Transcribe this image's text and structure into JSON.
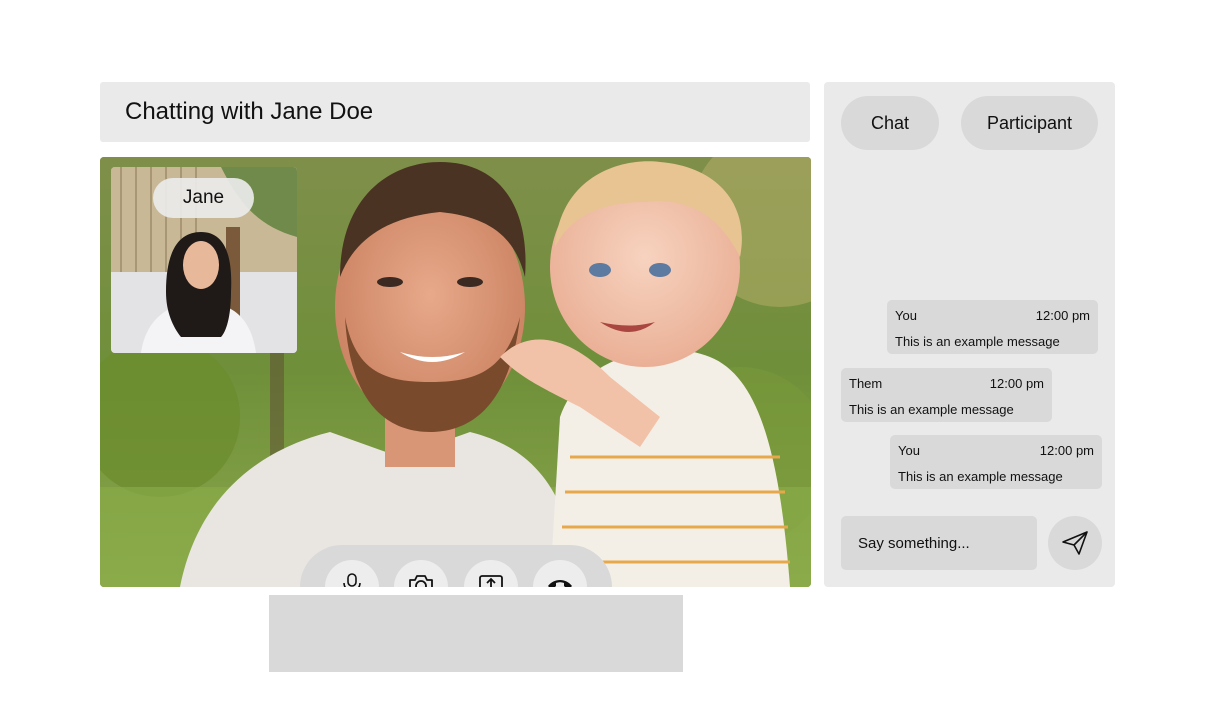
{
  "header": {
    "title": "Chatting with Jane Doe"
  },
  "pip": {
    "label": "Jane"
  },
  "controls": {
    "items": [
      {
        "icon": "microphone-icon"
      },
      {
        "icon": "camera-icon"
      },
      {
        "icon": "share-screen-icon"
      },
      {
        "icon": "end-call-icon"
      }
    ]
  },
  "side": {
    "tabs": [
      {
        "label": "Chat"
      },
      {
        "label": "Participant"
      }
    ],
    "messages": [
      {
        "sender": "You",
        "time": "12:00 pm",
        "text": "This is an example message"
      },
      {
        "sender": "Them",
        "time": "12:00 pm",
        "text": "This is an example message"
      },
      {
        "sender": "You",
        "time": "12:00 pm",
        "text": "This is an example message"
      }
    ],
    "input": {
      "placeholder": "Say something...",
      "value": ""
    },
    "send_icon": "send-icon"
  },
  "colors": {
    "panel": "#eaeaea",
    "control": "#d9d9d9"
  }
}
